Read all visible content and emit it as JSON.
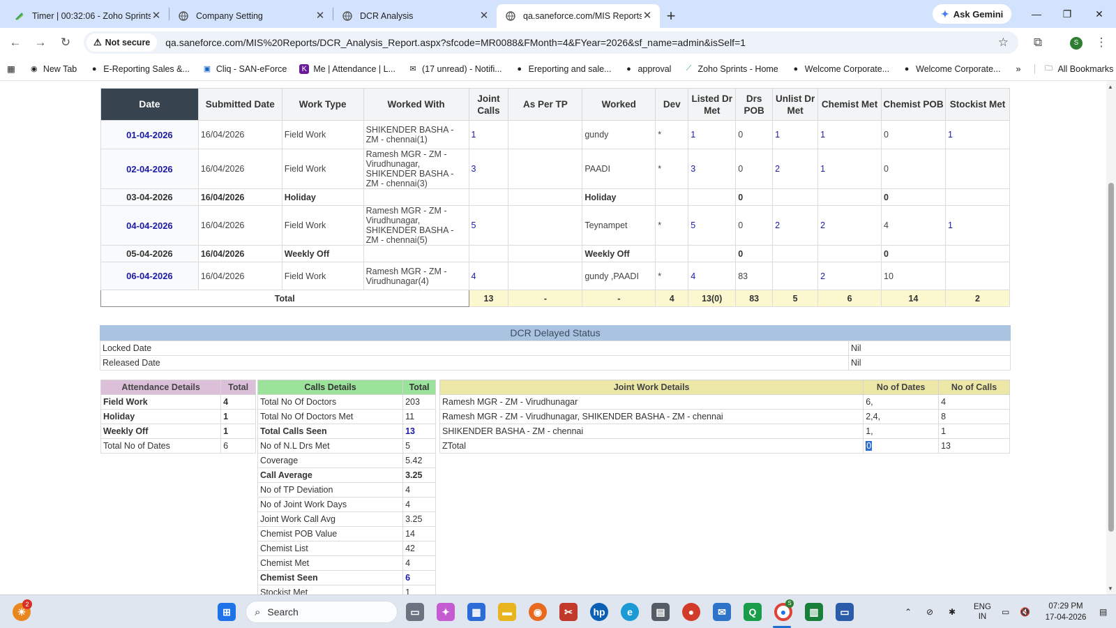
{
  "browser": {
    "tabs": [
      {
        "title": "Timer | 00:32:06 - Zoho Sprints",
        "icon": "zoho-sprints-icon",
        "active": false
      },
      {
        "title": "Company Setting",
        "icon": "globe-icon",
        "active": false
      },
      {
        "title": "DCR Analysis",
        "icon": "globe-icon",
        "active": false
      },
      {
        "title": "qa.saneforce.com/MIS Reports/",
        "icon": "globe-icon",
        "active": true
      }
    ],
    "ask_gemini": "Ask Gemini",
    "security_label": "Not secure",
    "url": "qa.saneforce.com/MIS%20Reports/DCR_Analysis_Report.aspx?sfcode=MR0088&FMonth=4&FYear=2026&sf_name=admin&isSelf=1",
    "bookmarks": [
      {
        "label": "New Tab",
        "icon": "chrome-icon"
      },
      {
        "label": "E-Reporting Sales &...",
        "icon": "globe-icon"
      },
      {
        "label": "Cliq - SAN-eForce",
        "icon": "cliq-icon"
      },
      {
        "label": "Me | Attendance | L...",
        "icon": "zoho-people-icon"
      },
      {
        "label": "(17 unread) - Notifi...",
        "icon": "mail-icon"
      },
      {
        "label": "Ereporting and sale...",
        "icon": "globe-icon"
      },
      {
        "label": "approval",
        "icon": "globe-icon"
      },
      {
        "label": "Zoho Sprints - Home",
        "icon": "zoho-sprints-icon"
      },
      {
        "label": "Welcome Corporate...",
        "icon": "globe-icon"
      },
      {
        "label": "Welcome Corporate...",
        "icon": "globe-icon"
      }
    ],
    "all_bookmarks": "All Bookmarks",
    "profile_initial": "S"
  },
  "report": {
    "headers": [
      "Date",
      "Submitted Date",
      "Work Type",
      "Worked With",
      "Joint Calls",
      "As Per TP",
      "Worked",
      "Dev",
      "Listed Dr Met",
      "Drs POB",
      "Unlist Dr Met",
      "Chemist Met",
      "Chemist POB",
      "Stockist Met"
    ],
    "rows": [
      {
        "date": "01-04-2026",
        "submitted": "16/04/2026",
        "work_type": "Field Work",
        "worked_with": "SHIKENDER BASHA - ZM - chennai(1)",
        "joint_calls": "1",
        "as_per_tp": "",
        "worked": "gundy",
        "dev": "*",
        "listed_dr_met": "1",
        "drs_pob": "0",
        "unlist_dr_met": "1",
        "chemist_met": "1",
        "chemist_pob": "0",
        "stockist_met": "1"
      },
      {
        "date": "02-04-2026",
        "submitted": "16/04/2026",
        "work_type": "Field Work",
        "worked_with": "Ramesh MGR - ZM - Virudhunagar, SHIKENDER BASHA - ZM - chennai(3)",
        "joint_calls": "3",
        "as_per_tp": "",
        "worked": "PAADI",
        "dev": "*",
        "listed_dr_met": "3",
        "drs_pob": "0",
        "unlist_dr_met": "2",
        "chemist_met": "1",
        "chemist_pob": "0",
        "stockist_met": ""
      },
      {
        "date": "03-04-2026",
        "submitted": "16/04/2026",
        "work_type": "Holiday",
        "worked_with": "",
        "joint_calls": "",
        "as_per_tp": "",
        "worked": "Holiday",
        "dev": "",
        "listed_dr_met": "",
        "drs_pob": "0",
        "unlist_dr_met": "",
        "chemist_met": "",
        "chemist_pob": "0",
        "stockist_met": ""
      },
      {
        "date": "04-04-2026",
        "submitted": "16/04/2026",
        "work_type": "Field Work",
        "worked_with": "Ramesh MGR - ZM - Virudhunagar, SHIKENDER BASHA - ZM - chennai(5)",
        "joint_calls": "5",
        "as_per_tp": "",
        "worked": "Teynampet",
        "dev": "*",
        "listed_dr_met": "5",
        "drs_pob": "0",
        "unlist_dr_met": "2",
        "chemist_met": "2",
        "chemist_pob": "4",
        "stockist_met": "1"
      },
      {
        "date": "05-04-2026",
        "submitted": "16/04/2026",
        "work_type": "Weekly Off",
        "worked_with": "",
        "joint_calls": "",
        "as_per_tp": "",
        "worked": "Weekly Off",
        "dev": "",
        "listed_dr_met": "",
        "drs_pob": "0",
        "unlist_dr_met": "",
        "chemist_met": "",
        "chemist_pob": "0",
        "stockist_met": ""
      },
      {
        "date": "06-04-2026",
        "submitted": "16/04/2026",
        "work_type": "Field Work",
        "worked_with": "Ramesh MGR - ZM - Virudhunagar(4)",
        "joint_calls": "4",
        "as_per_tp": "",
        "worked": "gundy ,PAADI",
        "dev": "*",
        "listed_dr_met": "4",
        "drs_pob": "83",
        "unlist_dr_met": "",
        "chemist_met": "2",
        "chemist_pob": "10",
        "stockist_met": ""
      }
    ],
    "total": {
      "label": "Total",
      "joint_calls": "13",
      "as_per_tp": "-",
      "worked": "-",
      "dev": "4",
      "listed_dr_met": "13(0)",
      "drs_pob": "83",
      "unlist_dr_met": "5",
      "chemist_met": "6",
      "chemist_pob": "14",
      "stockist_met": "2"
    }
  },
  "delayed": {
    "title": "DCR Delayed Status",
    "rows": [
      {
        "label": "Locked Date",
        "value": "Nil"
      },
      {
        "label": "Released Date",
        "value": "Nil"
      }
    ]
  },
  "attendance": {
    "header": "Attendance Details",
    "total_header": "Total",
    "rows": [
      {
        "label": "Field Work",
        "value": "4"
      },
      {
        "label": "Holiday",
        "value": "1"
      },
      {
        "label": "Weekly Off",
        "value": "1"
      },
      {
        "label": "Total No of Dates",
        "value": "6"
      }
    ]
  },
  "calls": {
    "header": "Calls Details",
    "total_header": "Total",
    "rows": [
      {
        "label": "Total No Of Doctors",
        "value": "203"
      },
      {
        "label": "Total No Of Doctors Met",
        "value": "11"
      },
      {
        "label": "Total Calls Seen",
        "value": "13"
      },
      {
        "label": "No of N.L Drs Met",
        "value": "5"
      },
      {
        "label": "Coverage",
        "value": "5.42"
      },
      {
        "label": "Call Average",
        "value": "3.25"
      },
      {
        "label": "No of TP Deviation",
        "value": "4"
      },
      {
        "label": "No of Joint Work Days",
        "value": "4"
      },
      {
        "label": "Joint Work Call Avg",
        "value": "3.25"
      },
      {
        "label": "Chemist POB Value",
        "value": "14"
      },
      {
        "label": "Chemist List",
        "value": "42"
      },
      {
        "label": "Chemist Met",
        "value": "4"
      },
      {
        "label": "Chemist Seen",
        "value": "6"
      },
      {
        "label": "Stockist Met",
        "value": "1"
      }
    ]
  },
  "joint": {
    "header": "Joint Work Details",
    "dates_header": "No of Dates",
    "calls_header": "No of Calls",
    "rows": [
      {
        "name": "Ramesh MGR - ZM - Virudhunagar",
        "dates": "6,",
        "calls": "4"
      },
      {
        "name": "Ramesh MGR - ZM - Virudhunagar, SHIKENDER BASHA - ZM - chennai",
        "dates": "2,4,",
        "calls": "8"
      },
      {
        "name": "SHIKENDER BASHA - ZM - chennai",
        "dates": "1,",
        "calls": "1"
      },
      {
        "name": "ZTotal",
        "dates": "0",
        "calls": "13"
      }
    ]
  },
  "taskbar": {
    "notification_count": "2",
    "search_placeholder": "Search",
    "lang_line1": "ENG",
    "lang_line2": "IN",
    "time": "07:29 PM",
    "date": "17-04-2026",
    "chrome_badge": "S"
  }
}
